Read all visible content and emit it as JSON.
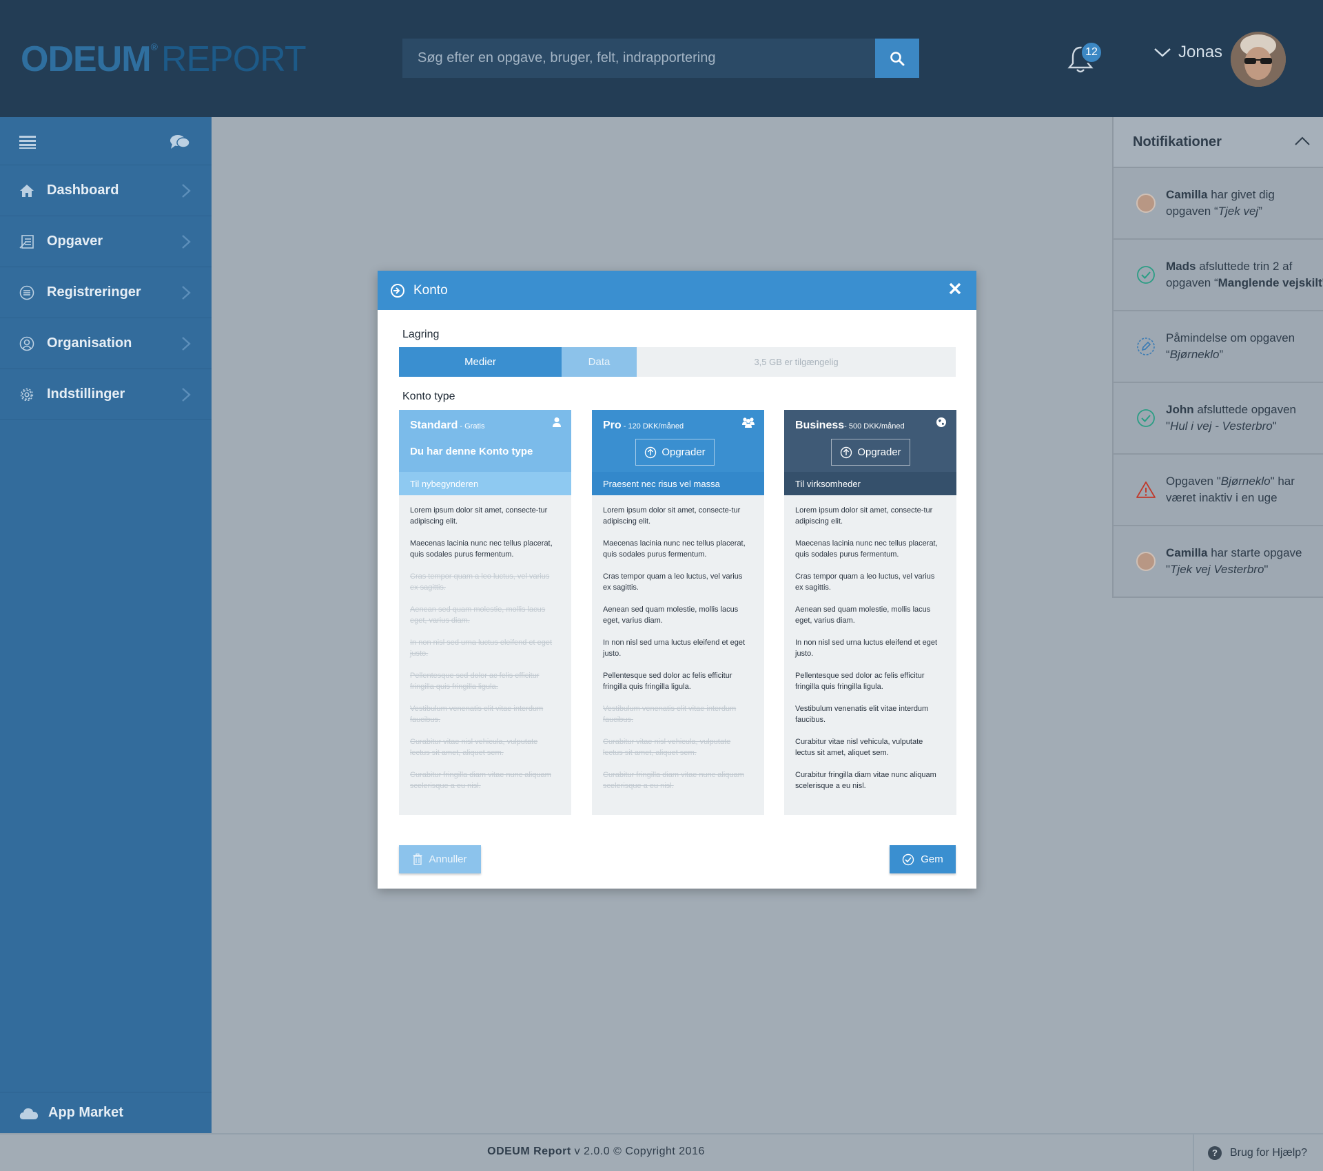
{
  "header": {
    "logo_main": "ODEUM",
    "logo_reg": "®",
    "logo_sub": "REPORT",
    "search_placeholder": "Søg efter en opgave, bruger, felt, indrapportering",
    "notification_count": "12",
    "user_name": "Jonas"
  },
  "sidebar": {
    "items": [
      {
        "label": "Dashboard",
        "icon": "home-icon"
      },
      {
        "label": "Opgaver",
        "icon": "tasks-icon"
      },
      {
        "label": "Registreringer",
        "icon": "registrations-icon"
      },
      {
        "label": "Organisation",
        "icon": "organisation-icon"
      },
      {
        "label": "Indstillinger",
        "icon": "settings-icon"
      }
    ],
    "app_market": "App Market"
  },
  "notifications": {
    "title": "Notifikationer",
    "items": [
      {
        "icon": "avatar",
        "bold": "Camilla",
        "line1": " har givet dig",
        "line2_pre": "opgaven “",
        "italic": "Tjek vej",
        "line2_post": "”"
      },
      {
        "icon": "check-icon",
        "bold": "Mads",
        "line1": " afsluttede trin 2 af",
        "line2_pre": "opgaven “",
        "bold2": "Manglende vejskilt",
        "line2_post": "”"
      },
      {
        "icon": "edit-icon",
        "line1": "Påmindelse om opgaven",
        "line2_pre": "“",
        "italic": "Bjørneklo",
        "line2_post": "”"
      },
      {
        "icon": "check-icon",
        "bold": "John",
        "line1": " afsluttede opgaven",
        "line2_pre": "\"",
        "italic": "Hul i vej - Vesterbro",
        "line2_post": "\""
      },
      {
        "icon": "warning-icon",
        "line1_pre": "Opgaven \"",
        "italic1": "Bjørneklo",
        "line1_post": "\" har",
        "line2_pre": "været inaktiv i en uge"
      },
      {
        "icon": "avatar",
        "bold": "Camilla",
        "line1": " har starte opgave",
        "line2_pre": "\"",
        "italic": "Tjek vej Vesterbro",
        "line2_post": "\""
      }
    ]
  },
  "modal": {
    "title": "Konto",
    "storage_label": "Lagring",
    "storage": {
      "media_label": "Medier",
      "data_label": "Data",
      "available": "3,5 GB er tilgængelig"
    },
    "account_type_label": "Konto type",
    "plans": [
      {
        "name": "Standard",
        "price": " - Gratis",
        "current_text": "Du har denne Konto type",
        "subtitle": "Til nybegynderen",
        "icon": "user-icon",
        "features": [
          {
            "text": "Lorem ipsum dolor sit amet, consecte-tur adipiscing elit.",
            "included": true
          },
          {
            "text": "Maecenas lacinia nunc nec tellus placerat, quis sodales purus fermentum.",
            "included": true
          },
          {
            "text": "Cras tempor quam a leo luctus, vel varius ex sagittis.",
            "included": false
          },
          {
            "text": "Aenean sed quam molestie, mollis lacus eget, varius diam.",
            "included": false
          },
          {
            "text": "In non nisl sed urna luctus eleifend et eget justo.",
            "included": false
          },
          {
            "text": "Pellentesque sed dolor ac felis efficitur fringilla quis fringilla ligula.",
            "included": false
          },
          {
            "text": "Vestibulum venenatis elit vitae interdum faucibus.",
            "included": false
          },
          {
            "text": "Curabitur vitae nisl vehicula, vulputate lectus sit amet, aliquet sem.",
            "included": false
          },
          {
            "text": "Curabitur fringilla diam vitae nunc aliquam scelerisque a eu nisl.",
            "included": false
          }
        ]
      },
      {
        "name": "Pro",
        "price": " - 120 DKK/måned",
        "upgrade_label": "Opgrader",
        "subtitle": "Praesent nec risus vel massa",
        "icon": "group-icon",
        "features": [
          {
            "text": "Lorem ipsum dolor sit amet, consecte-tur adipiscing elit.",
            "included": true
          },
          {
            "text": "Maecenas lacinia nunc nec tellus placerat, quis sodales purus fermentum.",
            "included": true
          },
          {
            "text": "Cras tempor quam a leo luctus, vel varius ex sagittis.",
            "included": true
          },
          {
            "text": "Aenean sed quam molestie, mollis lacus eget, varius diam.",
            "included": true
          },
          {
            "text": "In non nisl sed urna luctus eleifend et eget justo.",
            "included": true
          },
          {
            "text": "Pellentesque sed dolor ac felis efficitur fringilla quis fringilla ligula.",
            "included": true
          },
          {
            "text": "Vestibulum venenatis elit vitae interdum faucibus.",
            "included": false
          },
          {
            "text": "Curabitur vitae nisl vehicula, vulputate lectus sit amet, aliquet sem.",
            "included": false
          },
          {
            "text": "Curabitur fringilla diam vitae nunc aliquam scelerisque a eu nisl.",
            "included": false
          }
        ]
      },
      {
        "name": "Business",
        "price": "- 500 DKK/måned",
        "upgrade_label": "Opgrader",
        "subtitle": "Til virksomheder",
        "icon": "globe-icon",
        "features": [
          {
            "text": "Lorem ipsum dolor sit amet, consecte-tur adipiscing elit.",
            "included": true
          },
          {
            "text": "Maecenas lacinia nunc nec tellus placerat, quis sodales purus fermentum.",
            "included": true
          },
          {
            "text": "Cras tempor quam a leo luctus, vel varius ex sagittis.",
            "included": true
          },
          {
            "text": "Aenean sed quam molestie, mollis lacus eget, varius diam.",
            "included": true
          },
          {
            "text": "In non nisl sed urna luctus eleifend et eget justo.",
            "included": true
          },
          {
            "text": "Pellentesque sed dolor ac felis efficitur fringilla quis fringilla ligula.",
            "included": true
          },
          {
            "text": "Vestibulum venenatis elit vitae interdum faucibus.",
            "included": true
          },
          {
            "text": "Curabitur vitae nisl vehicula, vulputate lectus sit amet, aliquet sem.",
            "included": true
          },
          {
            "text": "Curabitur fringilla diam vitae nunc aliquam scelerisque a eu nisl.",
            "included": true
          }
        ]
      }
    ],
    "cancel_label": "Annuller",
    "save_label": "Gem"
  },
  "footer": {
    "brand": "ODEUM Report",
    "version": " v 2.0.0 © Copyright 2016",
    "help_label": "Brug for Hjælp?"
  },
  "colors": {
    "header_bg": "#233d55",
    "sidebar_bg": "#336c9c",
    "accent": "#3a8fd0",
    "overlay_bg": "#a2acb5",
    "business_bg": "#3f5a76"
  }
}
